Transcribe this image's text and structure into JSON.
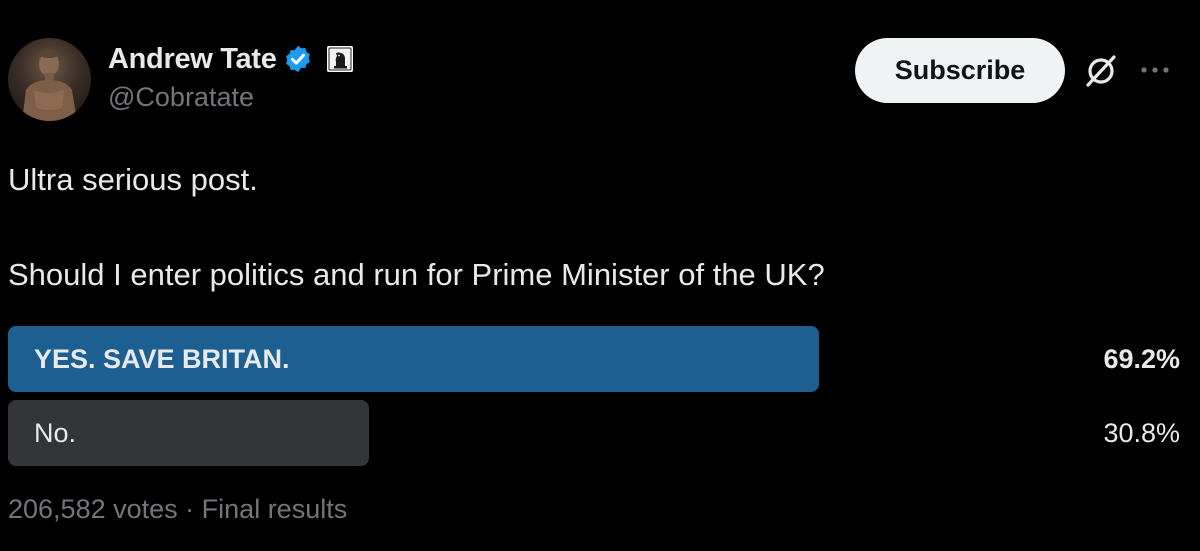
{
  "author": {
    "display_name": "Andrew Tate",
    "handle": "@Cobratate",
    "verified_icon": "verified-badge-icon",
    "affiliate_icon": "chess-knight-icon"
  },
  "actions": {
    "subscribe_label": "Subscribe",
    "grok_icon": "grok-icon",
    "more_icon": "more-icon"
  },
  "post": {
    "line1": "Ultra serious post.",
    "line2": "Should I enter politics and run for Prime Minister of the UK?"
  },
  "poll": {
    "options": [
      {
        "label": "YES. SAVE BRITAN.",
        "percent_text": "69.2%",
        "percent": 69.2,
        "winner": true
      },
      {
        "label": "No.",
        "percent_text": "30.8%",
        "percent": 30.8,
        "winner": false
      }
    ],
    "votes": "206,582 votes",
    "separator": "·",
    "status": "Final results"
  },
  "colors": {
    "background": "#000000",
    "text": "#e7e9ea",
    "muted": "#71767b",
    "winner_bar": "#1d5f91",
    "loser_bar": "#333639",
    "verified": "#1d9bf0"
  }
}
